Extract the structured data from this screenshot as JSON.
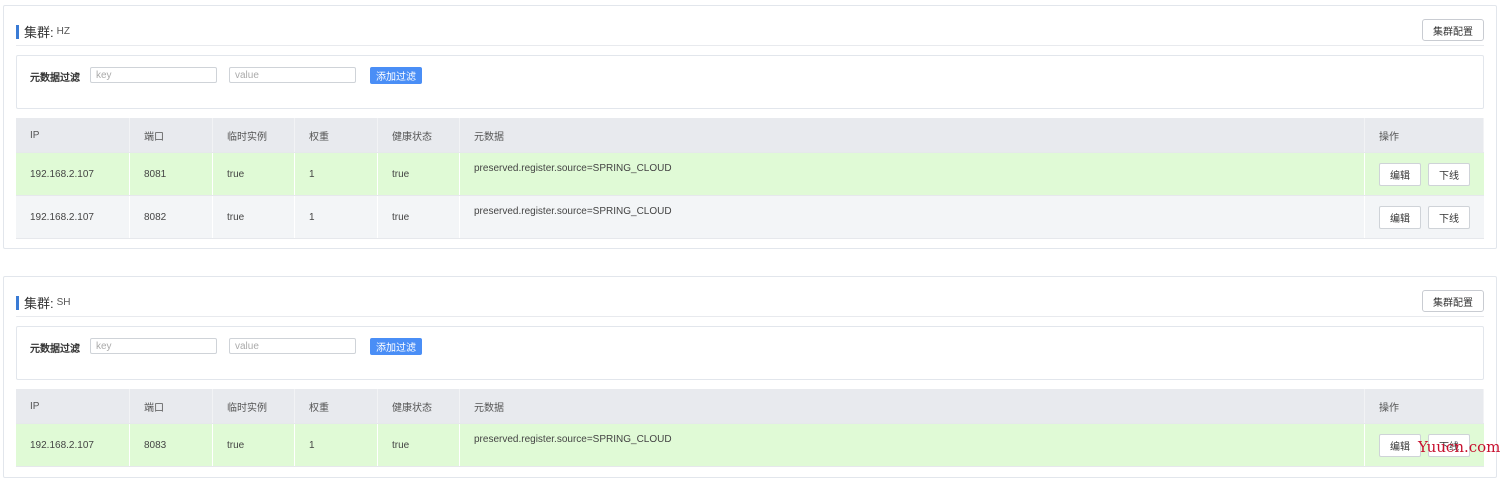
{
  "clusters": [
    {
      "title_label": "集群:",
      "name": "HZ",
      "config_button": "集群配置",
      "filter": {
        "label": "元数据过滤",
        "key_placeholder": "key",
        "value_placeholder": "value",
        "add_button": "添加过滤"
      },
      "columns": [
        "IP",
        "端口",
        "临时实例",
        "权重",
        "健康状态",
        "元数据",
        "操作"
      ],
      "rows": [
        {
          "ip": "192.168.2.107",
          "port": "8081",
          "ephemeral": "true",
          "weight": "1",
          "healthy": "true",
          "metadata": "preserved.register.source=SPRING_CLOUD",
          "edit": "编辑",
          "offline": "下线"
        },
        {
          "ip": "192.168.2.107",
          "port": "8082",
          "ephemeral": "true",
          "weight": "1",
          "healthy": "true",
          "metadata": "preserved.register.source=SPRING_CLOUD",
          "edit": "编辑",
          "offline": "下线"
        }
      ]
    },
    {
      "title_label": "集群:",
      "name": "SH",
      "config_button": "集群配置",
      "filter": {
        "label": "元数据过滤",
        "key_placeholder": "key",
        "value_placeholder": "value",
        "add_button": "添加过滤"
      },
      "columns": [
        "IP",
        "端口",
        "临时实例",
        "权重",
        "健康状态",
        "元数据",
        "操作"
      ],
      "rows": [
        {
          "ip": "192.168.2.107",
          "port": "8083",
          "ephemeral": "true",
          "weight": "1",
          "healthy": "true",
          "metadata": "preserved.register.source=SPRING_CLOUD",
          "edit": "编辑",
          "offline": "下线"
        }
      ]
    }
  ],
  "watermark": "Yuucn.com",
  "colors": {
    "accent": "#3a7bd5",
    "button_primary": "#4a8ef6",
    "healthy_row": "#e0fad6",
    "alt_row": "#f3f5f7",
    "watermark": "#c8102e"
  }
}
